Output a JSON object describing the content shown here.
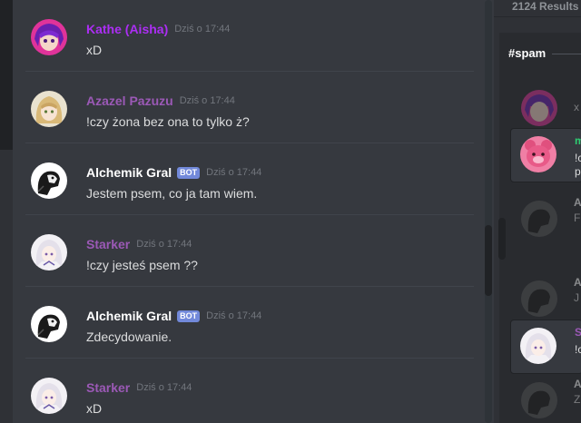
{
  "messages": [
    {
      "author": "Kathe (Aisha)",
      "color": "#ac2ef4",
      "timestamp": "Dziś o 17:44",
      "text": "xD",
      "bot": false,
      "avatar": "avatar-purple-anime"
    },
    {
      "author": "Azazel Pazuzu",
      "color": "#9b59b6",
      "timestamp": "Dziś o 17:44",
      "text": "!czy żona bez ona to tylko ż?",
      "bot": false,
      "avatar": "avatar-blonde-anime"
    },
    {
      "author": "Alchemik Gral",
      "color": "#ffffff",
      "timestamp": "Dziś o 17:44",
      "text": "Jestem psem, co ja tam wiem.",
      "bot": true,
      "bot_label": "BOT",
      "avatar": "avatar-dog-sketch"
    },
    {
      "author": "Starker",
      "color": "#9b59b6",
      "timestamp": "Dziś o 17:44",
      "text": "!czy jesteś psem ??",
      "bot": false,
      "avatar": "avatar-white-hair-anime"
    },
    {
      "author": "Alchemik Gral",
      "color": "#ffffff",
      "timestamp": "Dziś o 17:44",
      "text": "Zdecydowanie.",
      "bot": true,
      "bot_label": "BOT",
      "avatar": "avatar-dog-sketch"
    },
    {
      "author": "Starker",
      "color": "#9b59b6",
      "timestamp": "Dziś o 17:44",
      "text": "xD",
      "bot": false,
      "avatar": "avatar-white-hair-anime"
    }
  ],
  "search": {
    "results_count": "2124 Results",
    "channel": "#spam",
    "results": [
      {
        "name": "",
        "text": "x",
        "name_color": "#ac2ef4",
        "avatar": "avatar-purple-anime",
        "highlight": false,
        "dim": true
      },
      {
        "name": "m",
        "text": "!c",
        "text2": "p",
        "name_color": "#2ecc71",
        "avatar": "avatar-pink-bear",
        "highlight": true,
        "dim": false
      },
      {
        "name": "A",
        "text": "F",
        "name_color": "#ffffff",
        "avatar": "avatar-dog-sketch",
        "highlight": false,
        "dim": true
      },
      {
        "name": "A",
        "text": "J",
        "name_color": "#ffffff",
        "avatar": "avatar-dog-sketch",
        "highlight": false,
        "dim": true
      },
      {
        "name": "S",
        "text": "!c",
        "name_color": "#9b59b6",
        "avatar": "avatar-white-hair-anime",
        "highlight": true,
        "dim": false
      },
      {
        "name": "A",
        "text": "Z",
        "name_color": "#ffffff",
        "avatar": "avatar-dog-sketch",
        "highlight": false,
        "dim": true
      }
    ]
  },
  "colors": {
    "chat_bg": "#36393f",
    "panel_bg": "#2f3136",
    "bot_badge": "#7289da",
    "timestamp": "#72767d",
    "message_text": "#dcddde"
  }
}
